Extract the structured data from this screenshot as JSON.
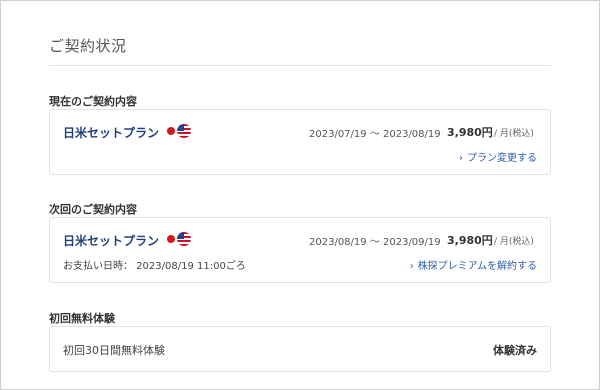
{
  "page_title": "ご契約状況",
  "current_contract": {
    "heading": "現在のご契約内容",
    "plan_name": "日米セットプラン",
    "flags": [
      "japan-flag-icon",
      "usa-flag-icon"
    ],
    "period": "2023/07/19 ～ 2023/08/19",
    "price": "3,980円",
    "price_unit": "/ 月(税込)",
    "change_link_label": "プラン変更する"
  },
  "next_contract": {
    "heading": "次回のご契約内容",
    "plan_name": "日米セットプラン",
    "flags": [
      "japan-flag-icon",
      "usa-flag-icon"
    ],
    "period": "2023/08/19 ～ 2023/09/19",
    "price": "3,980円",
    "price_unit": "/ 月(税込)",
    "payment_date": "お支払い日時： 2023/08/19 11:00ごろ",
    "cancel_link_label": "株探プレミアムを解約する"
  },
  "free_trial": {
    "heading": "初回無料体験",
    "label": "初回30日間無料体験",
    "status": "体験済み"
  },
  "colors": {
    "accent_link": "#2f5ea8",
    "plan_name": "#1f3f7a",
    "border": "#e2e2e2"
  }
}
